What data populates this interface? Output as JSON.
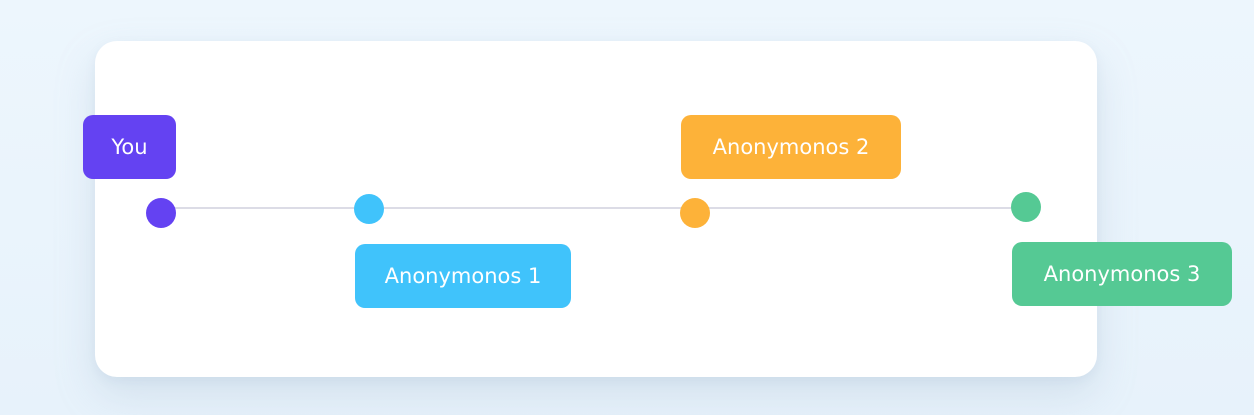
{
  "participants": [
    {
      "label": "You",
      "color": "#6442f2"
    },
    {
      "label": "Anonymonos 1",
      "color": "#40c3fb"
    },
    {
      "label": "Anonymonos 2",
      "color": "#fdb239"
    },
    {
      "label": "Anonymonos 3",
      "color": "#55c994"
    }
  ],
  "timeline": {
    "track_color": "#dcdce6"
  }
}
